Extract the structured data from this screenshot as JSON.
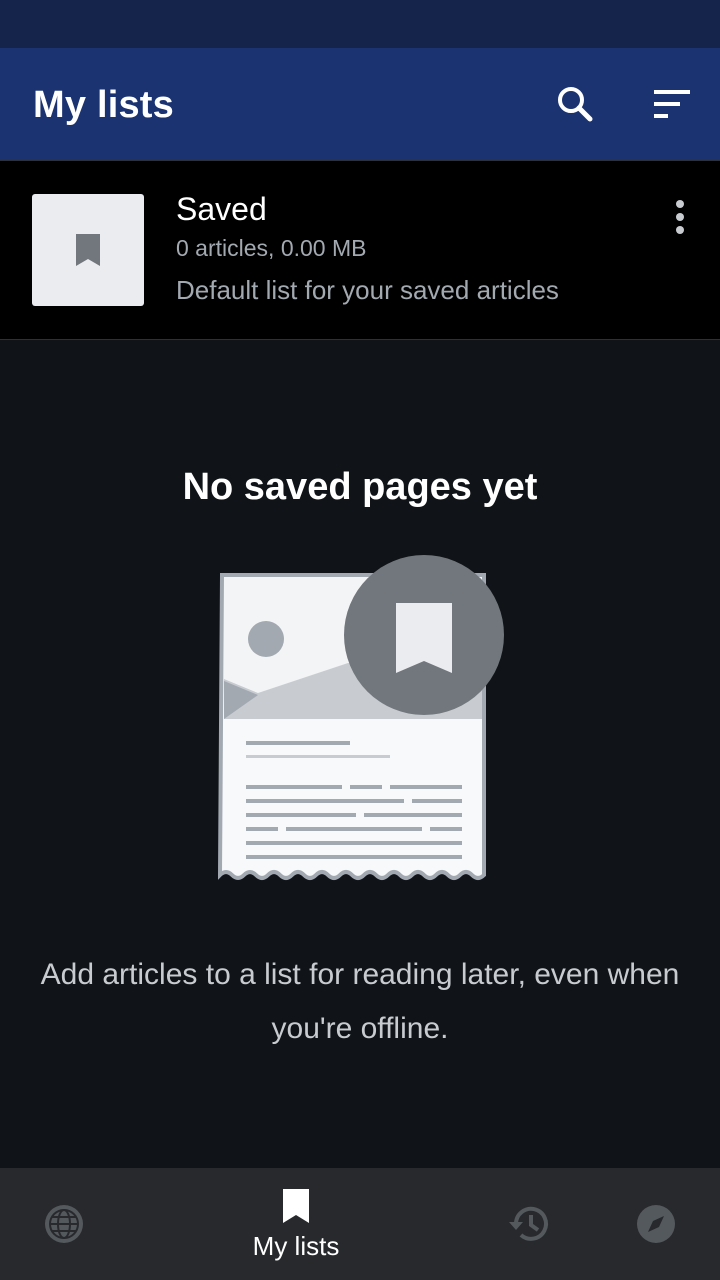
{
  "header": {
    "title": "My lists",
    "search_icon": "search-icon",
    "sort_icon": "sort-icon"
  },
  "list": {
    "name": "Saved",
    "meta": "0 articles, 0.00 MB",
    "description": "Default list for your saved articles",
    "icon": "bookmark-icon",
    "menu_icon": "more-vertical-icon"
  },
  "empty_state": {
    "title": "No saved pages yet",
    "message": "Add articles to a list for reading later, even when you're offline."
  },
  "bottom_nav": {
    "items": [
      {
        "icon": "globe-icon",
        "label": ""
      },
      {
        "icon": "bookmark-icon",
        "label": "My lists",
        "active": true
      },
      {
        "icon": "history-icon",
        "label": ""
      },
      {
        "icon": "compass-icon",
        "label": ""
      }
    ]
  },
  "colors": {
    "status_bar": "#15244a",
    "app_bar": "#1b3370",
    "background": "#101418",
    "list_background": "#000000",
    "nav_background": "#27292d",
    "secondary_text": "#a2a9b1"
  }
}
